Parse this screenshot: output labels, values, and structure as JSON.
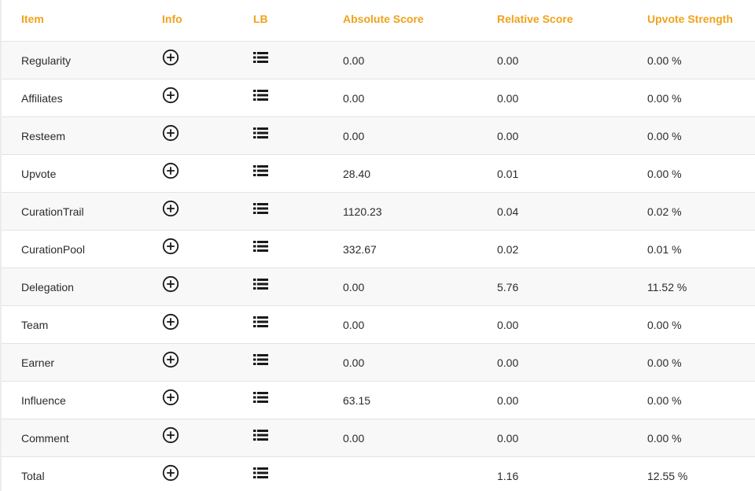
{
  "header": {
    "item": "Item",
    "info": "Info",
    "lb": "LB",
    "absolute_score": "Absolute Score",
    "relative_score": "Relative Score",
    "upvote_strength": "Upvote Strength"
  },
  "icons": {
    "info": "plus-circle-icon",
    "lb": "list-icon"
  },
  "colors": {
    "header_text": "#f0a21b",
    "alt_row": "#f8f8f8"
  },
  "rows": [
    {
      "item": "Regularity",
      "absolute": "0.00",
      "relative": "0.00",
      "upvote": "0.00 %"
    },
    {
      "item": "Affiliates",
      "absolute": "0.00",
      "relative": "0.00",
      "upvote": "0.00 %"
    },
    {
      "item": "Resteem",
      "absolute": "0.00",
      "relative": "0.00",
      "upvote": "0.00 %"
    },
    {
      "item": "Upvote",
      "absolute": "28.40",
      "relative": "0.01",
      "upvote": "0.00 %"
    },
    {
      "item": "CurationTrail",
      "absolute": "1120.23",
      "relative": "0.04",
      "upvote": "0.02 %"
    },
    {
      "item": "CurationPool",
      "absolute": "332.67",
      "relative": "0.02",
      "upvote": "0.01 %"
    },
    {
      "item": "Delegation",
      "absolute": "0.00",
      "relative": "5.76",
      "upvote": "11.52 %"
    },
    {
      "item": "Team",
      "absolute": "0.00",
      "relative": "0.00",
      "upvote": "0.00 %"
    },
    {
      "item": "Earner",
      "absolute": "0.00",
      "relative": "0.00",
      "upvote": "0.00 %"
    },
    {
      "item": "Influence",
      "absolute": "63.15",
      "relative": "0.00",
      "upvote": "0.00 %"
    },
    {
      "item": "Comment",
      "absolute": "0.00",
      "relative": "0.00",
      "upvote": "0.00 %"
    },
    {
      "item": "Total",
      "absolute": "",
      "relative": "1.16",
      "upvote": "12.55 %"
    }
  ]
}
